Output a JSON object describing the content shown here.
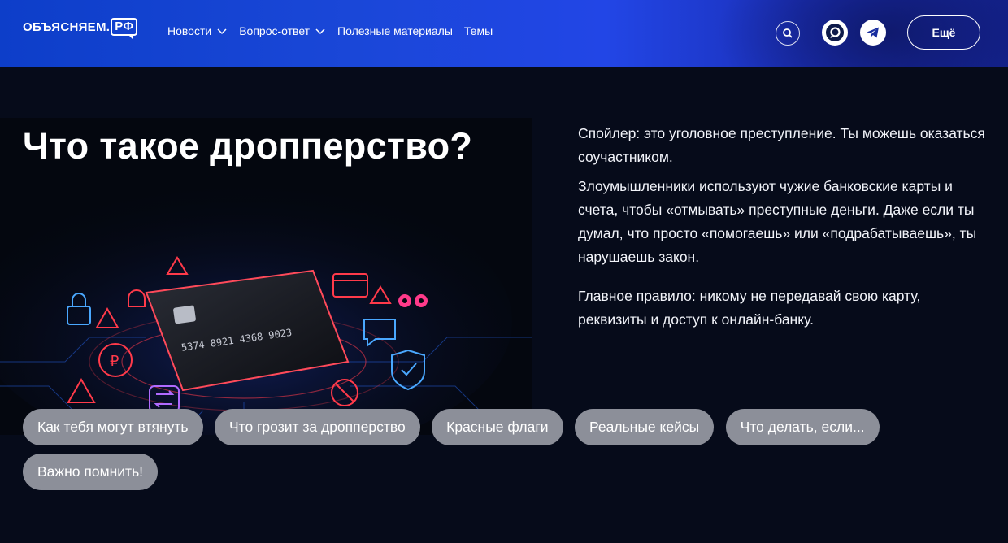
{
  "header": {
    "logo_text": "ОБЪЯСНЯЕМ.",
    "logo_badge": "РФ",
    "nav": [
      {
        "label": "Новости",
        "has_dropdown": true
      },
      {
        "label": "Вопрос-ответ",
        "has_dropdown": true
      },
      {
        "label": "Полезные материалы",
        "has_dropdown": false
      },
      {
        "label": "Темы",
        "has_dropdown": false
      }
    ],
    "icons": [
      "search-icon",
      "max-messenger-icon",
      "telegram-icon"
    ],
    "more_label": "Ещё"
  },
  "hero": {
    "title": "Что такое дропперство?",
    "card_number": "5374 8921 4368 9023",
    "paragraphs": [
      "Спойлер: это уголовное преступление. Ты можешь оказаться соучастником.",
      "Злоумышленники используют чужие банковские карты и счета, чтобы «отмывать» преступные деньги.  Даже если ты думал, что просто «помогаешь» или «подрабатываешь», ты нарушаешь закон.",
      "Главное правило: никому не передавай свою карту, реквизиты и доступ к онлайн-банку."
    ]
  },
  "chips": [
    "Как тебя могут втянуть",
    "Что грозит за дропперство",
    "Красные флаги",
    "Реальные кейсы",
    "Что делать, если...",
    "Важно помнить!"
  ],
  "colors": {
    "background": "#060b1a",
    "header_start": "#0d3ec9",
    "header_end": "#14228f",
    "chip": "#8c8f99",
    "accent_red": "#ff3a4a",
    "accent_blue": "#3aa0ff"
  }
}
